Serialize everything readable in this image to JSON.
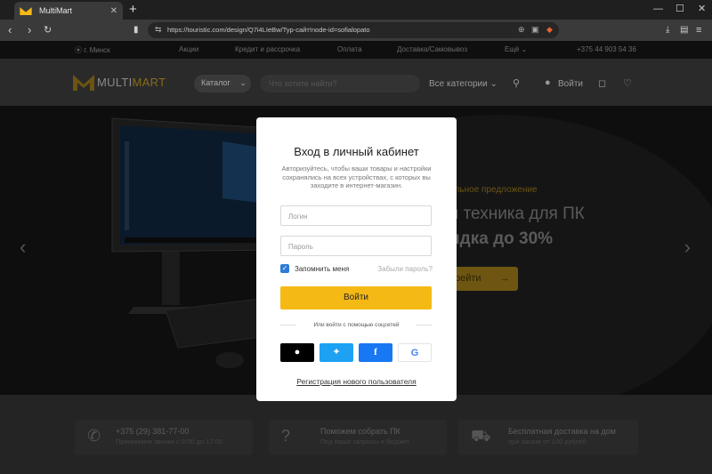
{
  "browser": {
    "tab_title": "MultiMart",
    "tab_close": "✕",
    "new_tab": "+",
    "url": "https://touristic.com/design/Q7i4LIeBw/Typ-сайт!node-id=sofialopato",
    "window_controls": [
      "—",
      "☐",
      "✕"
    ]
  },
  "infobar": {
    "city": "г. Минск",
    "links": [
      "Акции",
      "Кредит и рассрочка",
      "Оплата",
      "Доставка/Самовывоз",
      "Ещё"
    ],
    "phone": "+375 44 903 54 36"
  },
  "header": {
    "logo_main": "MULTI",
    "logo_accent": "MART",
    "catalog_label": "Каталог",
    "search_placeholder": "Что хотите найти?",
    "all_categories_label": "Все категории",
    "login_label": "Войти"
  },
  "hero": {
    "subtitle": "альное предложение",
    "title": "я техника для ПК",
    "discount": "идка до 30%",
    "button_label": "рейти"
  },
  "features": [
    {
      "title": "+375 (29) 381-77-00",
      "subtitle": "Принимаем звонки с 9:00 до 17:00",
      "icon": "phone-icon"
    },
    {
      "title": "Поможем собрать ПК",
      "subtitle": "Под ваши запросы и бюджет",
      "icon": "question-icon"
    },
    {
      "title": "Бесплатная доставка на дом",
      "subtitle": "при заказе от 100 рублей",
      "icon": "truck-icon"
    }
  ],
  "modal": {
    "title": "Вход в личный кабинет",
    "description": "Авторизуйтесь, чтобы ваши товары и настройки сохранялись на всех устройствах, с которых вы заходите в интернет-магазин.",
    "login_placeholder": "Логин",
    "password_placeholder": "Пароль",
    "remember_label": "Запомнить меня",
    "remember_checked": true,
    "forgot_label": "Забыли пароль?",
    "submit_label": "Войти",
    "social_label": "Или войти с помощью соцсетей",
    "social": [
      {
        "name": "apple",
        "icon": "apple-icon",
        "color": "#000000"
      },
      {
        "name": "twitter",
        "icon": "twitter-icon",
        "color": "#1da1f2"
      },
      {
        "name": "facebook",
        "icon": "facebook-icon",
        "color": "#1877f2"
      },
      {
        "name": "google",
        "icon": "google-icon",
        "color": "#ffffff"
      }
    ],
    "register_label": "Регистрация нового пользователя"
  },
  "colors": {
    "accent": "#f5b915",
    "checkbox": "#2e7bd6",
    "overlay": "#000000"
  }
}
